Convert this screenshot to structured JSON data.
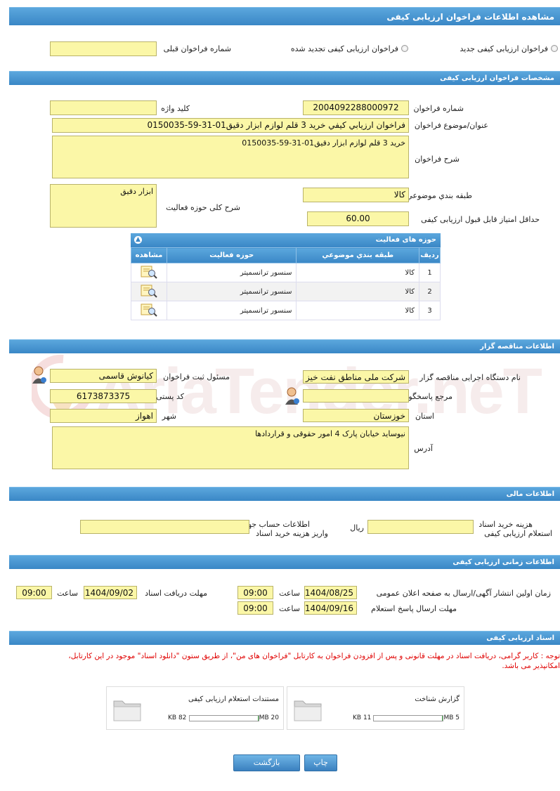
{
  "page_title": "مشاهده اطلاعات فراخوان ارزیابی کیفی",
  "type_options": {
    "new_label": "فراخوان ارزیابی کیفی جدید",
    "renewed_label": "فراخوان ارزیابی کیفی تجدید شده",
    "prev_number_label": "شماره فراخوان قبلی",
    "prev_number_value": ""
  },
  "spec": {
    "header": "مشخصات فراخوان ارزیابی کیفی",
    "number_label": "شماره فراخوان",
    "number_value": "2004092288000972",
    "keyword_label": "کلید واژه",
    "keyword_value": "",
    "subject_label": "عنوان/موضوع فراخوان",
    "subject_value": "فراخوان ارزیابي کیفي خريد 3 قلم لوازم ابزار دقیق01-31-59-0150035",
    "desc_label": "شرح فراخوان",
    "desc_value": "خريد 3 قلم لوازم ابزار دقیق01-31-59-0150035",
    "category_label": "طبقه بندي موضوعي",
    "category_value": "کالا",
    "min_score_label": "حداقل امتیاز قابل قبول ارزیابی کیفی",
    "min_score_value": "60.00",
    "scope_label": "شرح کلی حوزه فعالیت",
    "scope_value": "ابزار دقیق"
  },
  "activities": {
    "header": "حوزه های فعالیت",
    "columns": [
      "رديف",
      "طبقه بندي موضوعي",
      "حوزه فعالیت",
      "مشاهده"
    ],
    "rows": [
      {
        "idx": "1",
        "category": "کالا",
        "field": "سنسور ترانسمیتر"
      },
      {
        "idx": "2",
        "category": "کالا",
        "field": "سنسور ترانسمیتر"
      },
      {
        "idx": "3",
        "category": "کالا",
        "field": "سنسور ترانسمیتر"
      }
    ]
  },
  "org": {
    "header": "اطلاعات مناقصه گزار",
    "exec_label": "نام دستگاه اجرایی مناقصه گزار",
    "exec_value": "شرکت ملی مناطق نفت خیز",
    "registrar_label": "مسئول ثبت فراخوان",
    "registrar_value": "کیانوش  قاسمی",
    "ref_label": "مرجع پاسخگویی",
    "ref_value": "",
    "postal_label": "کد پستی",
    "postal_value": "6173873375",
    "province_label": "استان",
    "province_value": "خوزستان",
    "city_label": "شهر",
    "city_value": "اهواز",
    "address_label": "آدرس",
    "address_value": "نیوساید خیابان پارک 4 امور حقوقی و قراردادها"
  },
  "finance": {
    "header": "اطلاعات مالی",
    "fee_label_1": "هزینه خرید اسناد",
    "fee_label_2": "استعلام ارزیابی کیفی",
    "fee_value": "",
    "currency": "ریال",
    "account_label_1": "اطلاعات حساب جهت",
    "account_label_2": "واریز هزینه خرید اسناد",
    "account_value": ""
  },
  "timing": {
    "header": "اطلاعات زمانی ارزیابی کیفی",
    "publish_label": "زمان اولین انتشار آگهی/ارسال به صفحه اعلان عمومی",
    "publish_date": "1404/08/25",
    "publish_time": "09:00",
    "receive_label": "مهلت دریافت اسناد",
    "receive_date": "1404/09/02",
    "receive_time": "09:00",
    "response_label": "مهلت ارسال پاسخ استعلام",
    "response_date": "1404/09/16",
    "response_time": "09:00",
    "time_label": "ساعت"
  },
  "documents": {
    "header": "اسناد ارزیابی کیفی",
    "note_line1": "توجه : کاربر گرامی، دریافت اسناد در مهلت قانونی و پس از افزودن فراخوان به کارتابل \"فراخوان های من\"، از طریق ستون \"دانلود اسناد\" موجود در این کارتابل،",
    "note_line2": "امکانپذیر می باشد.",
    "files": [
      {
        "title": "گزارش شناخت",
        "size": "11 KB",
        "max": "5 MB",
        "ratio": 0.01
      },
      {
        "title": "مستندات استعلام ارزیابی کیفی",
        "size": "82 KB",
        "max": "20 MB",
        "ratio": 0.01
      }
    ]
  },
  "buttons": {
    "print": "چاپ",
    "back": "بازگشت"
  },
  "watermark": "AriaTender.neT",
  "colors": {
    "accent": "#3a87c6",
    "field_bg": "#fbf7a7",
    "note_red": "#e00000"
  }
}
